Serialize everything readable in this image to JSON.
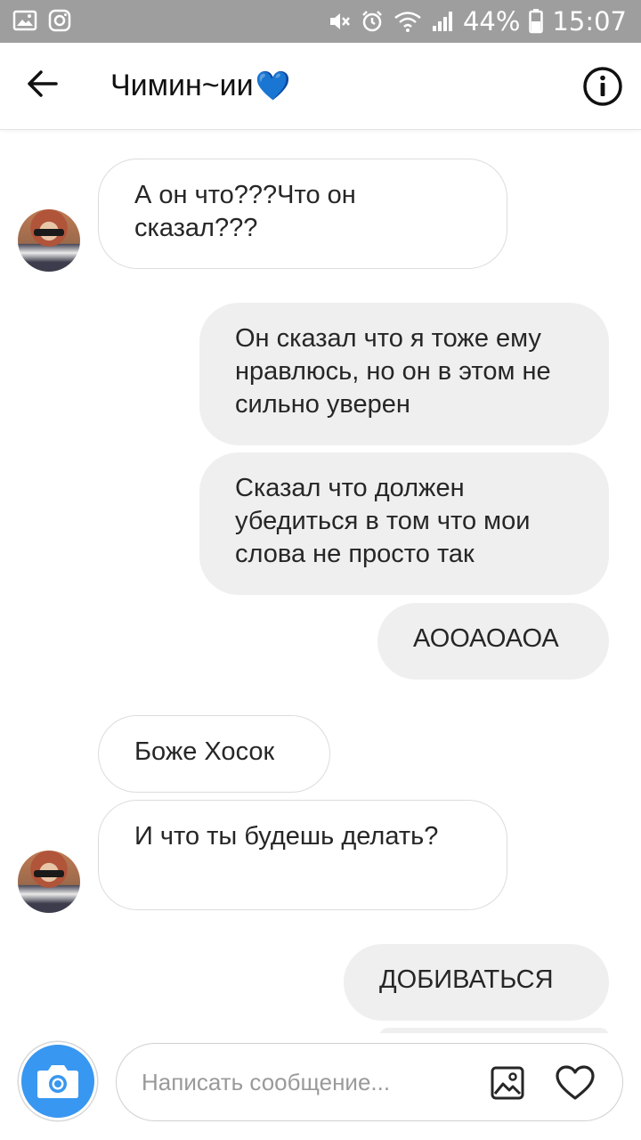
{
  "status_bar": {
    "battery": "44%",
    "time": "15:07",
    "icons": [
      "gallery-icon",
      "instagram-icon",
      "mute-icon",
      "alarm-icon",
      "wifi-icon",
      "signal-icon",
      "battery-icon"
    ]
  },
  "header": {
    "title": "Чимин~ии",
    "title_emoji": "💙",
    "back_icon": "arrow-left-icon",
    "info_icon": "info-icon"
  },
  "messages": [
    {
      "side": "incoming",
      "text": "А он что???Что он сказал???"
    },
    {
      "side": "outgoing",
      "text": "Он сказал что я тоже ему нравлюсь, но он в этом не сильно уверен"
    },
    {
      "side": "outgoing",
      "text": "Сказал что должен убедиться в том что мои слова не просто так"
    },
    {
      "side": "outgoing",
      "text": "АООАОАОА"
    },
    {
      "side": "incoming",
      "text": "Боже Хосок"
    },
    {
      "side": "incoming",
      "text": "И что ты будешь делать?"
    },
    {
      "side": "outgoing",
      "text": "ДОБИВАТЬСЯ"
    }
  ],
  "composer": {
    "placeholder": "Написать сообщение...",
    "value": "",
    "camera_icon": "camera-icon",
    "gallery_icon": "image-icon",
    "like_icon": "heart-icon"
  },
  "colors": {
    "status_bar_bg": "#9e9e9e",
    "outgoing_bubble": "#efefef",
    "incoming_border": "#dcdcdc",
    "camera_button": "#3897f0"
  }
}
